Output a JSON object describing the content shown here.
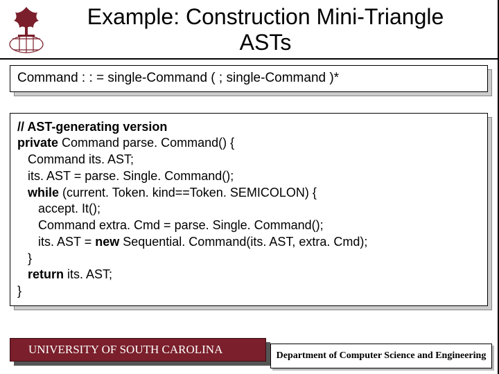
{
  "header": {
    "title_line1": "Example: Construction Mini-Triangle",
    "title_line2": "ASTs"
  },
  "grammar": {
    "text": "Command : : = single-Command ( ; single-Command )*"
  },
  "code": {
    "comment": "// AST-generating version",
    "l1a": "private ",
    "l1b": "Command parse. Command() {",
    "l2": "   Command its. AST;",
    "l3": "   its. AST = parse. Single. Command();",
    "l4a": "   while ",
    "l4b": "(current. Token. kind==Token. SEMICOLON) {",
    "l5": "      accept. It();",
    "l6": "      Command extra. Cmd = parse. Single. Command();",
    "l7a": "      its. AST = ",
    "l7b": "new ",
    "l7c": "Sequential. Command(its. AST, extra. Cmd);",
    "l8": "   }",
    "l9a": "   return ",
    "l9b": "its. AST;",
    "l10": "}"
  },
  "footer": {
    "left": "UNIVERSITY OF SOUTH CAROLINA",
    "right": "Department of Computer Science and Engineering"
  }
}
